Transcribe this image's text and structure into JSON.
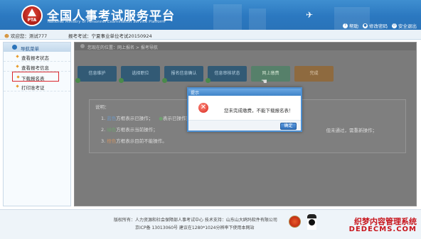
{
  "header": {
    "title": "全国人事考试服务平台",
    "subtitle": "National Ministry of Personnel Examination Service Platform",
    "logo_text": "PTA",
    "links": [
      {
        "icon": "help-icon",
        "label": "帮助"
      },
      {
        "icon": "password-icon",
        "label": "修改密码"
      },
      {
        "icon": "logout-icon",
        "label": "安全退出"
      }
    ]
  },
  "infobar": {
    "user": "欢迎您：测试777",
    "exam": "报考考试：宁夏事业单位考试20150924"
  },
  "sidebar": {
    "title": "导航菜单",
    "items": [
      {
        "label": "查看报考状态"
      },
      {
        "label": "查看报考信息"
      },
      {
        "label": "下载报名表"
      },
      {
        "label": "打印准考证"
      }
    ]
  },
  "main": {
    "breadcrumb": "您现在的位置：网上报名 > 报考导航",
    "steps": [
      {
        "label": "信息维护",
        "state": "done"
      },
      {
        "label": "选择职位",
        "state": "done"
      },
      {
        "label": "报名信息确认",
        "state": "done"
      },
      {
        "label": "信息审核状态",
        "state": "done"
      },
      {
        "label": "网上缴费",
        "state": "current"
      },
      {
        "label": "完成",
        "state": "todo"
      }
    ],
    "notes": {
      "label": "说明：",
      "row1_num": "1.",
      "row1_color": "蓝色",
      "row1_text": "方框表示已操作；",
      "row1_mid": "表示已操作完成",
      "row1_tail": "但未通过，需重新操作；",
      "row2_num": "2.",
      "row2_color": "绿色",
      "row2_text": "方框表示当前操作；",
      "row3_num": "3.",
      "row3_color": "橙色",
      "row3_text": "方框表示目前不能操作。"
    }
  },
  "dialog": {
    "title": "提示",
    "message": "您未完成缴费，不能下载报名表！",
    "ok_label": "确定"
  },
  "footer": {
    "line1": "版权所有：人力资源和社会保障部人事考试中心  技术支持：山东山大鸥玛软件有限公司",
    "line2": "京ICP备 13013060号  建议在1280*1024分辨率下使用本网站",
    "watermark1": "织梦内容管理系统",
    "watermark2": "DEDECMS.COM"
  },
  "colors": {
    "header_blue": "#2b78c0",
    "active_border": "#d9262c",
    "step_done": "#325a75",
    "step_current": "#56806a",
    "step_todo": "#8e6a3f"
  }
}
